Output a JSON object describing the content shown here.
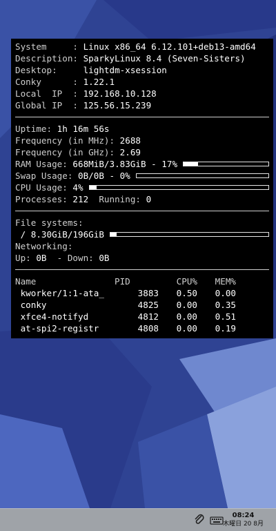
{
  "conky": {
    "system": [
      {
        "label": "System     : ",
        "value": "Linux x86_64 6.12.101+deb13-amd64"
      },
      {
        "label": "Description: ",
        "value": "SparkyLinux 8.4 (Seven-Sisters)"
      },
      {
        "label": "Desktop:     ",
        "value": "lightdm-xsession"
      },
      {
        "label": "Conky      : ",
        "value": "1.22.1"
      },
      {
        "label": "Local  IP  : ",
        "value": "192.168.10.128"
      },
      {
        "label": "Global IP  : ",
        "value": "125.56.15.239"
      }
    ],
    "uptime": {
      "label": "Uptime: ",
      "value": "1h 16m 56s"
    },
    "freq_mhz": {
      "label": "Frequency (in MHz): ",
      "value": "2688"
    },
    "freq_ghz": {
      "label": "Frequency (in GHz): ",
      "value": "2.69"
    },
    "ram": {
      "label": "RAM Usage: ",
      "value": "668MiB/3.83GiB - 17%",
      "percent": 17
    },
    "swap": {
      "label": "Swap Usage: ",
      "value": "0B/0B - 0%",
      "percent": 0
    },
    "cpu": {
      "label": "CPU Usage: ",
      "value": "4%",
      "percent": 4
    },
    "processes": {
      "label": "Processes: ",
      "value": "212",
      "running_label": "  Running: ",
      "running_value": "0"
    },
    "filesystems": {
      "label": "File systems:",
      "root": " / 8.30GiB/196GiB",
      "percent": 4
    },
    "networking": {
      "label": "Networking:",
      "up_label": "Up: ",
      "up_value": "0B",
      "down_label": "  - Down: ",
      "down_value": "0B"
    },
    "process_table": {
      "headers": [
        "Name",
        "PID",
        "CPU%",
        "MEM%"
      ],
      "rows": [
        {
          "name": " kworker/1:1-ata_",
          "pid": "3883",
          "cpu": "0.50",
          "mem": "0.00"
        },
        {
          "name": " conky",
          "pid": "4825",
          "cpu": "0.00",
          "mem": "0.35"
        },
        {
          "name": " xfce4-notifyd",
          "pid": "4812",
          "cpu": "0.00",
          "mem": "0.51"
        },
        {
          "name": " at-spi2-registr",
          "pid": "4808",
          "cpu": "0.00",
          "mem": "0.19"
        }
      ]
    }
  },
  "taskbar": {
    "time": "08:24",
    "date": "木曜日 20 8月",
    "tray_icons": [
      "paperclip-icon",
      "keyboard-icon"
    ]
  },
  "colors": {
    "panel_bg": "#000000",
    "text": "#d9d9d9",
    "value": "#ffffff",
    "taskbar": "#9fa3a8",
    "wallpaper": "#2c3f8f"
  }
}
